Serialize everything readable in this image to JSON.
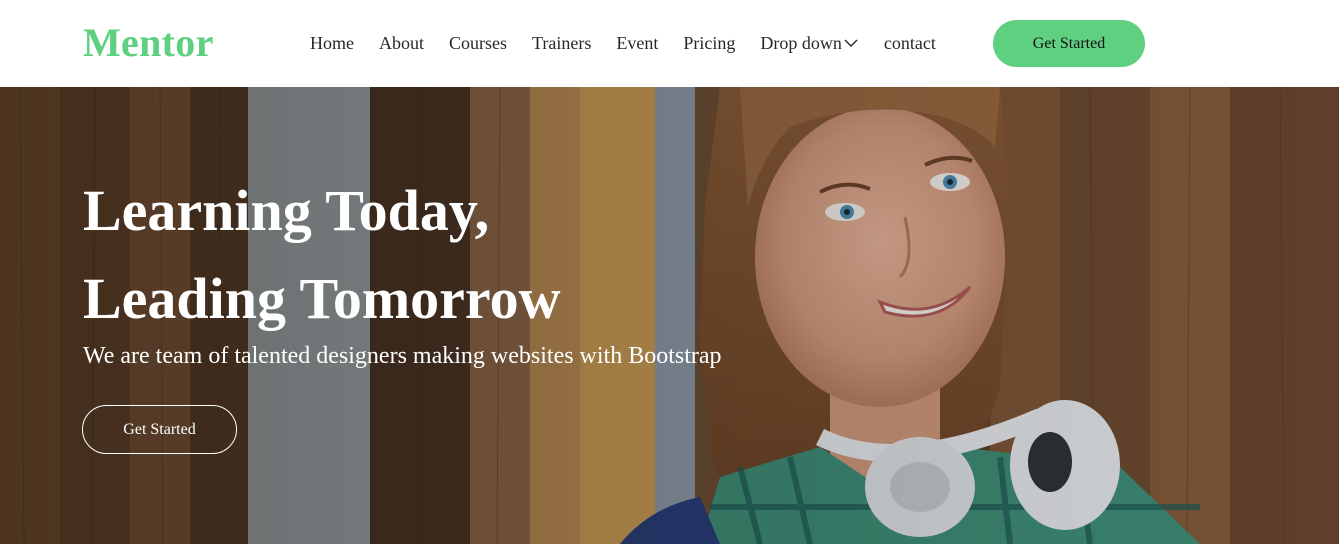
{
  "brand": {
    "logo_text": "Mentor",
    "accent_color": "#5fcf80"
  },
  "nav": {
    "items": [
      {
        "label": "Home"
      },
      {
        "label": "About"
      },
      {
        "label": "Courses"
      },
      {
        "label": "Trainers"
      },
      {
        "label": "Event"
      },
      {
        "label": "Pricing"
      },
      {
        "label": "Drop down",
        "icon": "chevron-down-icon"
      },
      {
        "label": "contact"
      }
    ],
    "cta_label": "Get Started"
  },
  "hero": {
    "title_line1": "Learning Today,",
    "title_line2": "Leading Tomorrow",
    "subtitle": "We are team of talented designers making websites with Bootstrap",
    "cta_label": "Get Started",
    "image": "smiling-student-with-headphones-photo"
  }
}
